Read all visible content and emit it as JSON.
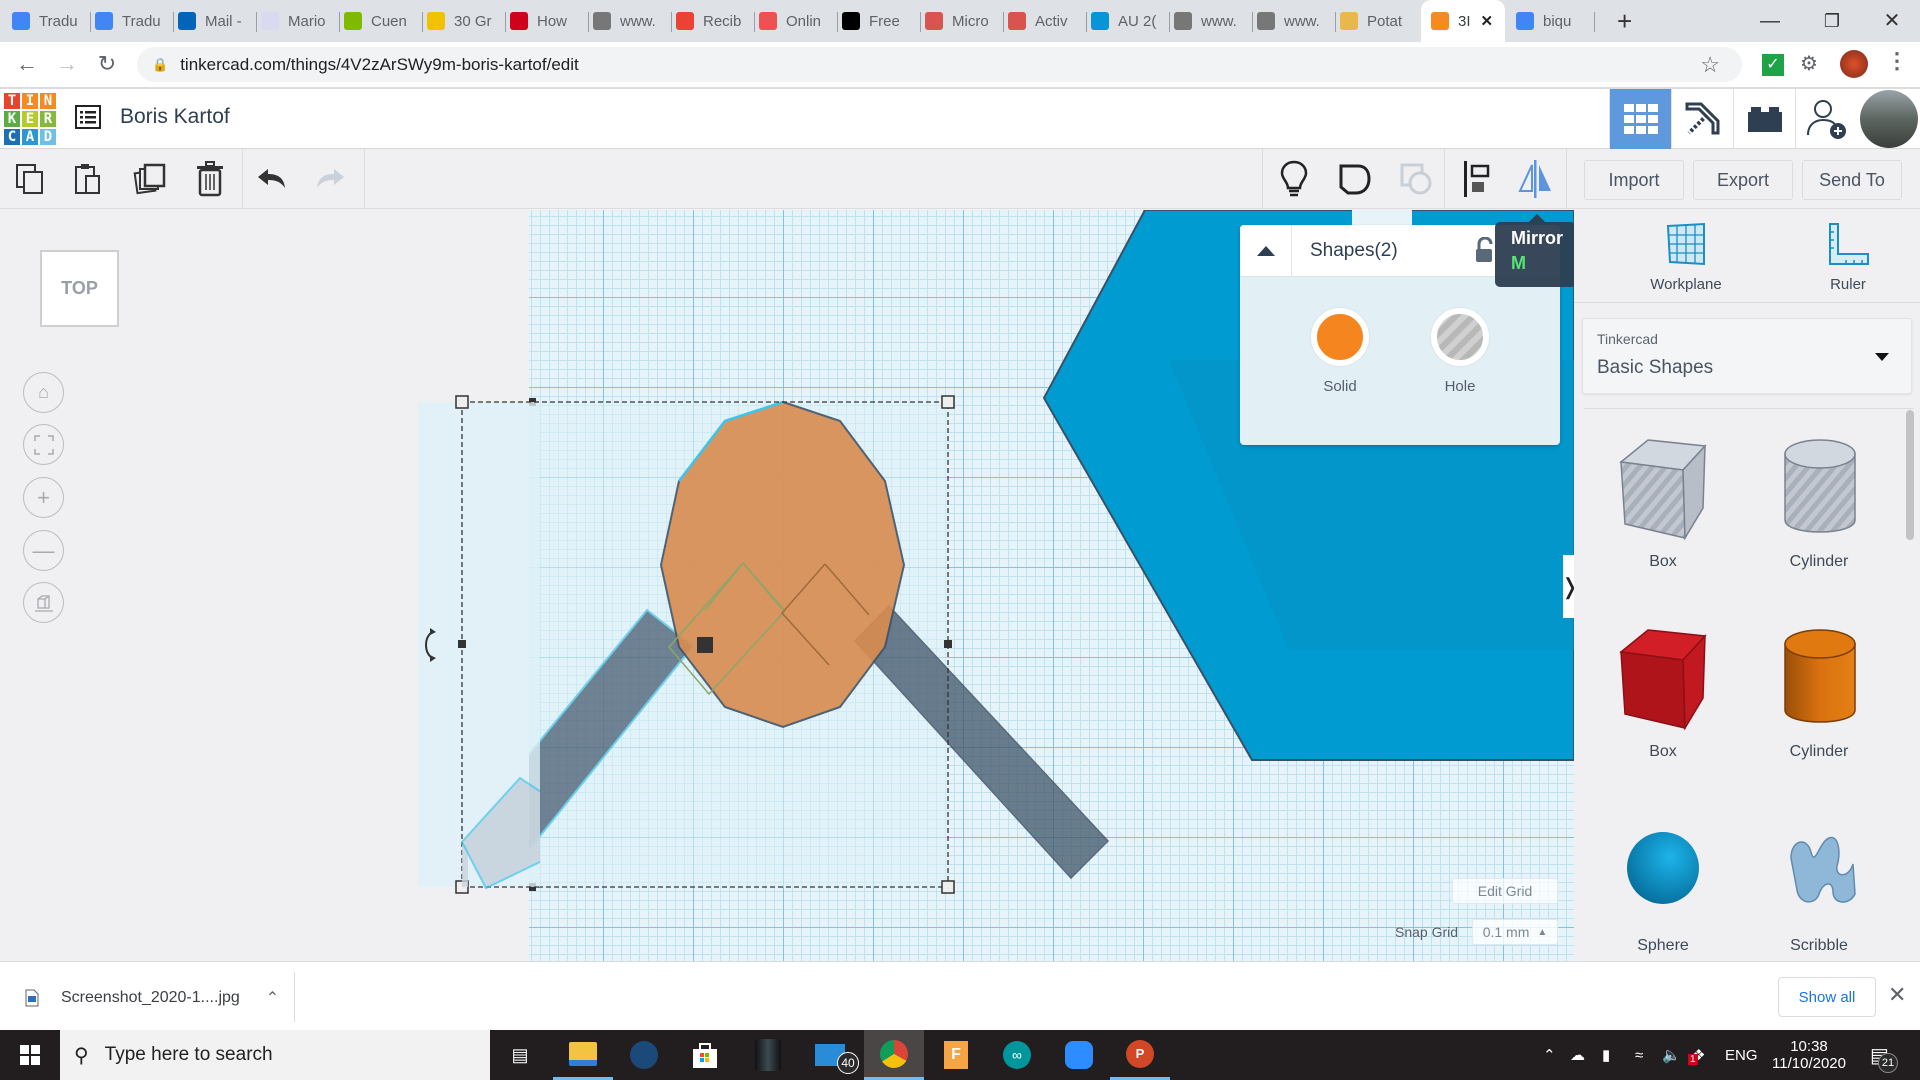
{
  "browser": {
    "tabs": [
      {
        "label": "Tradu",
        "icon": "google-translate-icon"
      },
      {
        "label": "Tradu",
        "icon": "google-translate-icon"
      },
      {
        "label": "Mail -",
        "icon": "outlook-icon"
      },
      {
        "label": "Mario",
        "icon": "columbia-icon"
      },
      {
        "label": "Cuen",
        "icon": "microsoft-icon"
      },
      {
        "label": "30 Gr",
        "icon": "c-logo-icon"
      },
      {
        "label": "How",
        "icon": "m-logo-icon"
      },
      {
        "label": "www.",
        "icon": "youtube-icon"
      },
      {
        "label": "Recib",
        "icon": "gmail-icon"
      },
      {
        "label": "Onlin",
        "icon": "udemy-icon"
      },
      {
        "label": "Free",
        "icon": "wix-icon"
      },
      {
        "label": "Micro",
        "icon": "app-icon"
      },
      {
        "label": "Activ",
        "icon": "app-icon"
      },
      {
        "label": "AU 2(",
        "icon": "autodesk-icon"
      },
      {
        "label": "www.",
        "icon": "youtube-icon"
      },
      {
        "label": "www.",
        "icon": "youtube-icon"
      },
      {
        "label": "Potat",
        "icon": "potato-icon"
      },
      {
        "label": "3I",
        "icon": "tinkercad-icon",
        "active": true
      },
      {
        "label": "biqu",
        "icon": "google-icon"
      }
    ],
    "new_tab": "+",
    "url": "tinkercad.com/things/4V2zArSWy9m-boris-kartof/edit"
  },
  "app": {
    "logo_letters": [
      "T",
      "I",
      "N",
      "K",
      "E",
      "R",
      "C",
      "A",
      "D"
    ],
    "logo_colors": [
      "#e8432b",
      "#f58a21",
      "#f58a21",
      "#5aac44",
      "#b5cb2a",
      "#84b93c",
      "#1f6fb5",
      "#2d97d3",
      "#6fbfe6"
    ],
    "design_title": "Boris Kartof",
    "header_icons": [
      "grid-view-icon",
      "pickaxe-icon",
      "bricks-icon",
      "add-user-icon",
      "profile-avatar"
    ]
  },
  "toolbar": {
    "left_icons": [
      "copy-icon",
      "paste-icon",
      "duplicate-icon",
      "delete-icon",
      "undo-icon",
      "redo-icon"
    ],
    "right_icons": [
      "notes-lightbulb-icon",
      "show-all-icon",
      "hide-icon",
      "align-icon",
      "mirror-icon"
    ],
    "import_label": "Import",
    "export_label": "Export",
    "send_to_label": "Send To"
  },
  "tooltip": {
    "title": "Mirror",
    "shortcut": "M"
  },
  "view": {
    "viewcube_label": "TOP",
    "controls": [
      "home-view",
      "fit-view",
      "zoom-in",
      "zoom-out",
      "perspective"
    ]
  },
  "shapes_panel": {
    "title": "Shapes(2)",
    "solid_label": "Solid",
    "hole_label": "Hole",
    "solid_color": "#f5851f"
  },
  "right_panel": {
    "workplane_label": "Workplane",
    "ruler_label": "Ruler",
    "library_provider": "Tinkercad",
    "library_name": "Basic Shapes",
    "shapes": [
      {
        "label": "Box",
        "kind": "box-hole"
      },
      {
        "label": "Cylinder",
        "kind": "cylinder-hole"
      },
      {
        "label": "Box",
        "kind": "box-solid",
        "color": "#c8161d"
      },
      {
        "label": "Cylinder",
        "kind": "cylinder-solid",
        "color": "#e07a10"
      },
      {
        "label": "Sphere",
        "kind": "sphere",
        "color": "#0a9ad1"
      },
      {
        "label": "Scribble",
        "kind": "scribble",
        "color": "#8fb8d8"
      }
    ]
  },
  "grid": {
    "edit_grid_label": "Edit Grid",
    "snap_grid_label": "Snap Grid",
    "snap_value": "0.1 mm"
  },
  "downloads": {
    "file_name": "Screenshot_2020-1....jpg",
    "show_all_label": "Show all"
  },
  "taskbar": {
    "search_placeholder": "Type here to search",
    "mail_badge": "40",
    "language": "ENG",
    "time": "10:38",
    "date": "11/10/2020",
    "notification_count": "21",
    "dropbox_badge": "1"
  }
}
